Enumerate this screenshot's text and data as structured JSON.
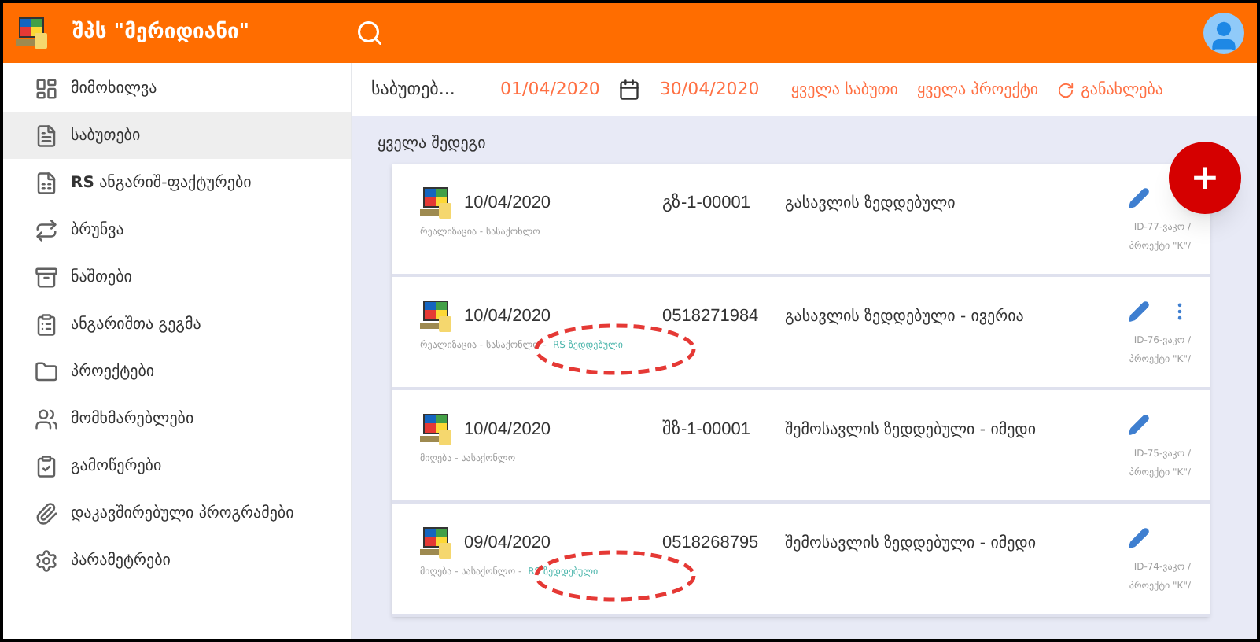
{
  "app": {
    "title": "შპს \"მერიდიანი\""
  },
  "sidebar": {
    "items": [
      {
        "label": "მიმოხილვა",
        "selected": false
      },
      {
        "label": "საბუთები",
        "selected": true
      },
      {
        "label": "**RS** ანგარიშ-ფაქტურები",
        "selected": false
      },
      {
        "label": "ბრუნვა",
        "selected": false
      },
      {
        "label": "ნაშთები",
        "selected": false
      },
      {
        "label": "ანგარიშთა გეგმა",
        "selected": false
      },
      {
        "label": "პროექტები",
        "selected": false
      },
      {
        "label": "მომხმარებლები",
        "selected": false
      },
      {
        "label": "გამოწერები",
        "selected": false
      },
      {
        "label": "დაკავშირებული პროგრამები",
        "selected": false
      },
      {
        "label": "პარამეტრები",
        "selected": false
      }
    ]
  },
  "toolbar": {
    "filter": "საბუთებ...",
    "date_from": "01/04/2020",
    "date_to": "30/04/2020",
    "links": [
      "ყველა საბუთი",
      "ყველა პროექტი"
    ],
    "refresh": "განახლება"
  },
  "section_title": "ყველა შედეგი",
  "rows": [
    {
      "date": "10/04/2020",
      "number": "გზ-1-00001",
      "title": "გასავლის ზედდებული",
      "subtitle": "რეალიზაცია - სასაქონლო",
      "id": "ID-77-ვაკო /",
      "project": "პროექტი \"K\"/",
      "more_button": false,
      "circled": false
    },
    {
      "date": "10/04/2020",
      "number": "0518271984",
      "title": "გასავლის ზედდებული - ივერია",
      "subtitle": "რეალიზაცია - სასაქონლო -",
      "rs_tag": "RS ზედდებული",
      "id": "ID-76-ვაკო /",
      "project": "პროექტი \"K\"/",
      "more_button": true,
      "circled": true
    },
    {
      "date": "10/04/2020",
      "number": "შზ-1-00001",
      "title": "შემოსავლის ზედდებული - იმედი",
      "subtitle": "მიღება - სასაქონლო",
      "id": "ID-75-ვაკო /",
      "project": "პროექტი \"K\"/",
      "more_button": false,
      "circled": false
    },
    {
      "date": "09/04/2020",
      "number": "0518268795",
      "title": "შემოსავლის ზედდებული - იმედი",
      "subtitle": "მიღება - სასაქონლო -",
      "rs_tag": "RS ზედდებული",
      "id": "ID-74-ვაკო /",
      "project": "პროექტი \"K\"/",
      "more_button": false,
      "circled": true
    }
  ],
  "fab": {
    "label": "+"
  }
}
